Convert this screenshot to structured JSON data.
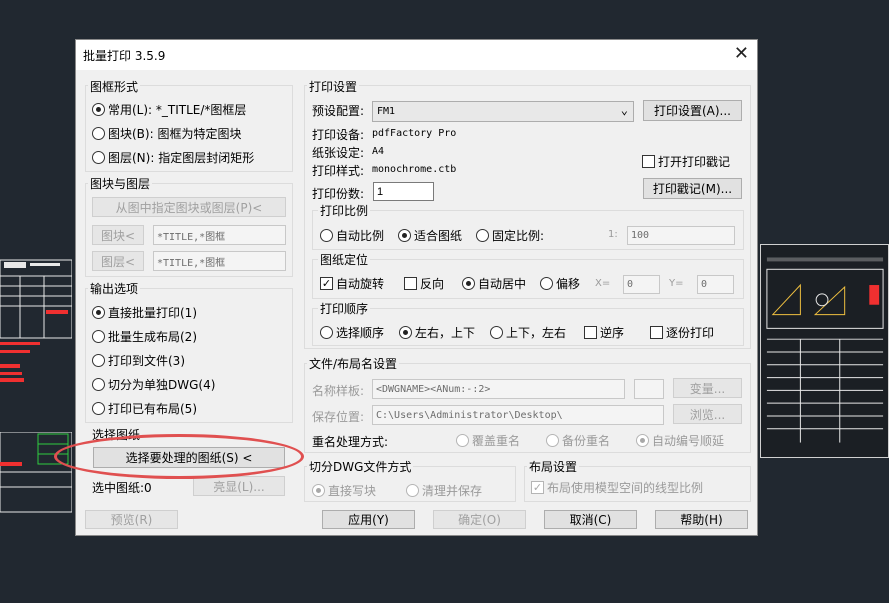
{
  "window": {
    "title": "批量打印 3.5.9"
  },
  "frame_type": {
    "label": "图框形式",
    "options": [
      "常用(L): *_TITLE/*图框层",
      "图块(B): 图框为特定图块",
      "图层(N): 指定图层封闭矩形"
    ]
  },
  "block_layer": {
    "label": "图块与图层",
    "pick_button": "从图中指定图块或图层(P)<",
    "block_button": "图块<",
    "block_value": "*TITLE,*图框",
    "layer_button": "图层<",
    "layer_value": "*TITLE,*图框"
  },
  "output": {
    "label": "输出选项",
    "options": [
      "直接批量打印(1)",
      "批量生成布局(2)",
      "打印到文件(3)",
      "切分为单独DWG(4)",
      "打印已有布局(5)"
    ]
  },
  "select_drawings": {
    "label": "选择图纸",
    "button": "选择要处理的图纸(S) <",
    "selected_label": "选中图纸:0",
    "highlight_button": "亮显(L)..."
  },
  "print_settings": {
    "label": "打印设置",
    "preset_label": "预设配置:",
    "preset_value": "FM1",
    "setup_button": "打印设置(A)...",
    "device_label": "打印设备:",
    "device_value": "pdfFactory Pro",
    "paper_label": "纸张设定:",
    "paper_value": "A4",
    "style_label": "打印样式:",
    "style_value": "monochrome.ctb",
    "copies_label": "打印份数:",
    "copies_value": "1",
    "open_stamp": "打开打印戳记",
    "stamp_button": "打印戳记(M)..."
  },
  "scale": {
    "label": "打印比例",
    "options": [
      "自动比例",
      "适合图纸",
      "固定比例:"
    ],
    "ratio_prefix": "1:",
    "ratio_value": "100"
  },
  "position": {
    "label": "图纸定位",
    "auto_rotate": "自动旋转",
    "reverse": "反向",
    "center": "自动居中",
    "offset": "偏移",
    "x_label": "X=",
    "x_value": "0",
    "y_label": "Y=",
    "y_value": "0"
  },
  "order": {
    "label": "打印顺序",
    "options": [
      "选择顺序",
      "左右，上下",
      "上下，左右"
    ],
    "reverse": "逆序",
    "by_copy": "逐份打印"
  },
  "file_naming": {
    "label": "文件/布局名设置",
    "template_label": "名称样板:",
    "template_value": "<DWGNAME><ANum:-:2>",
    "variable_button": "变量...",
    "save_label": "保存位置:",
    "save_value": "C:\\Users\\Administrator\\Desktop\\",
    "browse_button": "浏览...",
    "duplicate_label": "重名处理方式:",
    "duplicate_options": [
      "覆盖重名",
      "备份重名",
      "自动编号顺延"
    ]
  },
  "split": {
    "label": "切分DWG文件方式",
    "options": [
      "直接写块",
      "清理并保存"
    ]
  },
  "layout": {
    "label": "布局设置",
    "linetype": "布局使用模型空间的线型比例"
  },
  "footer": {
    "preview": "预览(R)",
    "apply": "应用(Y)",
    "ok": "确定(O)",
    "cancel": "取消(C)",
    "help": "帮助(H)"
  },
  "colors": {
    "highlight_ellipse": "#e05050",
    "cad_background": "#212830"
  }
}
